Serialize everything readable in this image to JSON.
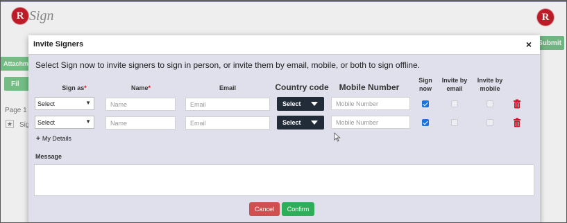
{
  "app": {
    "logo_letter": "R",
    "logo_text": "Sign",
    "brand_color": "#c81e2a"
  },
  "background": {
    "submit_label": "Submit",
    "attachments_label": "Attachm",
    "filter_label": "Fil",
    "page_label": "Page 1",
    "sig_label": "Sig"
  },
  "modal": {
    "title": "Invite Signers",
    "close_glyph": "×",
    "intro": "Select Sign now to invite signers to sign in person, or invite them by email, mobile, or both to sign offline.",
    "headers": {
      "sign_as": "Sign as",
      "name": "Name",
      "email": "Email",
      "country_code": "Country code",
      "mobile_number": "Mobile Number",
      "sign_now": "Sign now",
      "invite_by_email": "Invite by email",
      "invite_by_mobile": "Invite by mobile",
      "required_mark": "*"
    },
    "rows": [
      {
        "sign_as": "Select",
        "name_placeholder": "Name",
        "email_placeholder": "Email",
        "country_code": "Select",
        "mobile_placeholder": "Mobile Number",
        "sign_now": true,
        "invite_by_email": false,
        "invite_by_mobile": false
      },
      {
        "sign_as": "Select",
        "name_placeholder": "Name",
        "email_placeholder": "Email",
        "country_code": "Select",
        "mobile_placeholder": "Mobile Number",
        "sign_now": true,
        "invite_by_email": false,
        "invite_by_mobile": false
      }
    ],
    "my_details_icon": "+",
    "my_details_label": "My Details",
    "message_label": "Message",
    "cancel_label": "Cancel",
    "confirm_label": "Confirm"
  },
  "colors": {
    "accent_green": "#2fae5a",
    "cancel_red": "#d24f4f",
    "checkbox_blue": "#1a73d9",
    "country_code_bg": "#222b38"
  },
  "icons": {
    "logo": "r-logo-icon",
    "close": "close-icon",
    "dropdown": "chevron-down-icon",
    "delete": "trash-icon",
    "add": "plus-icon",
    "pointer": "mouse-cursor-icon"
  }
}
